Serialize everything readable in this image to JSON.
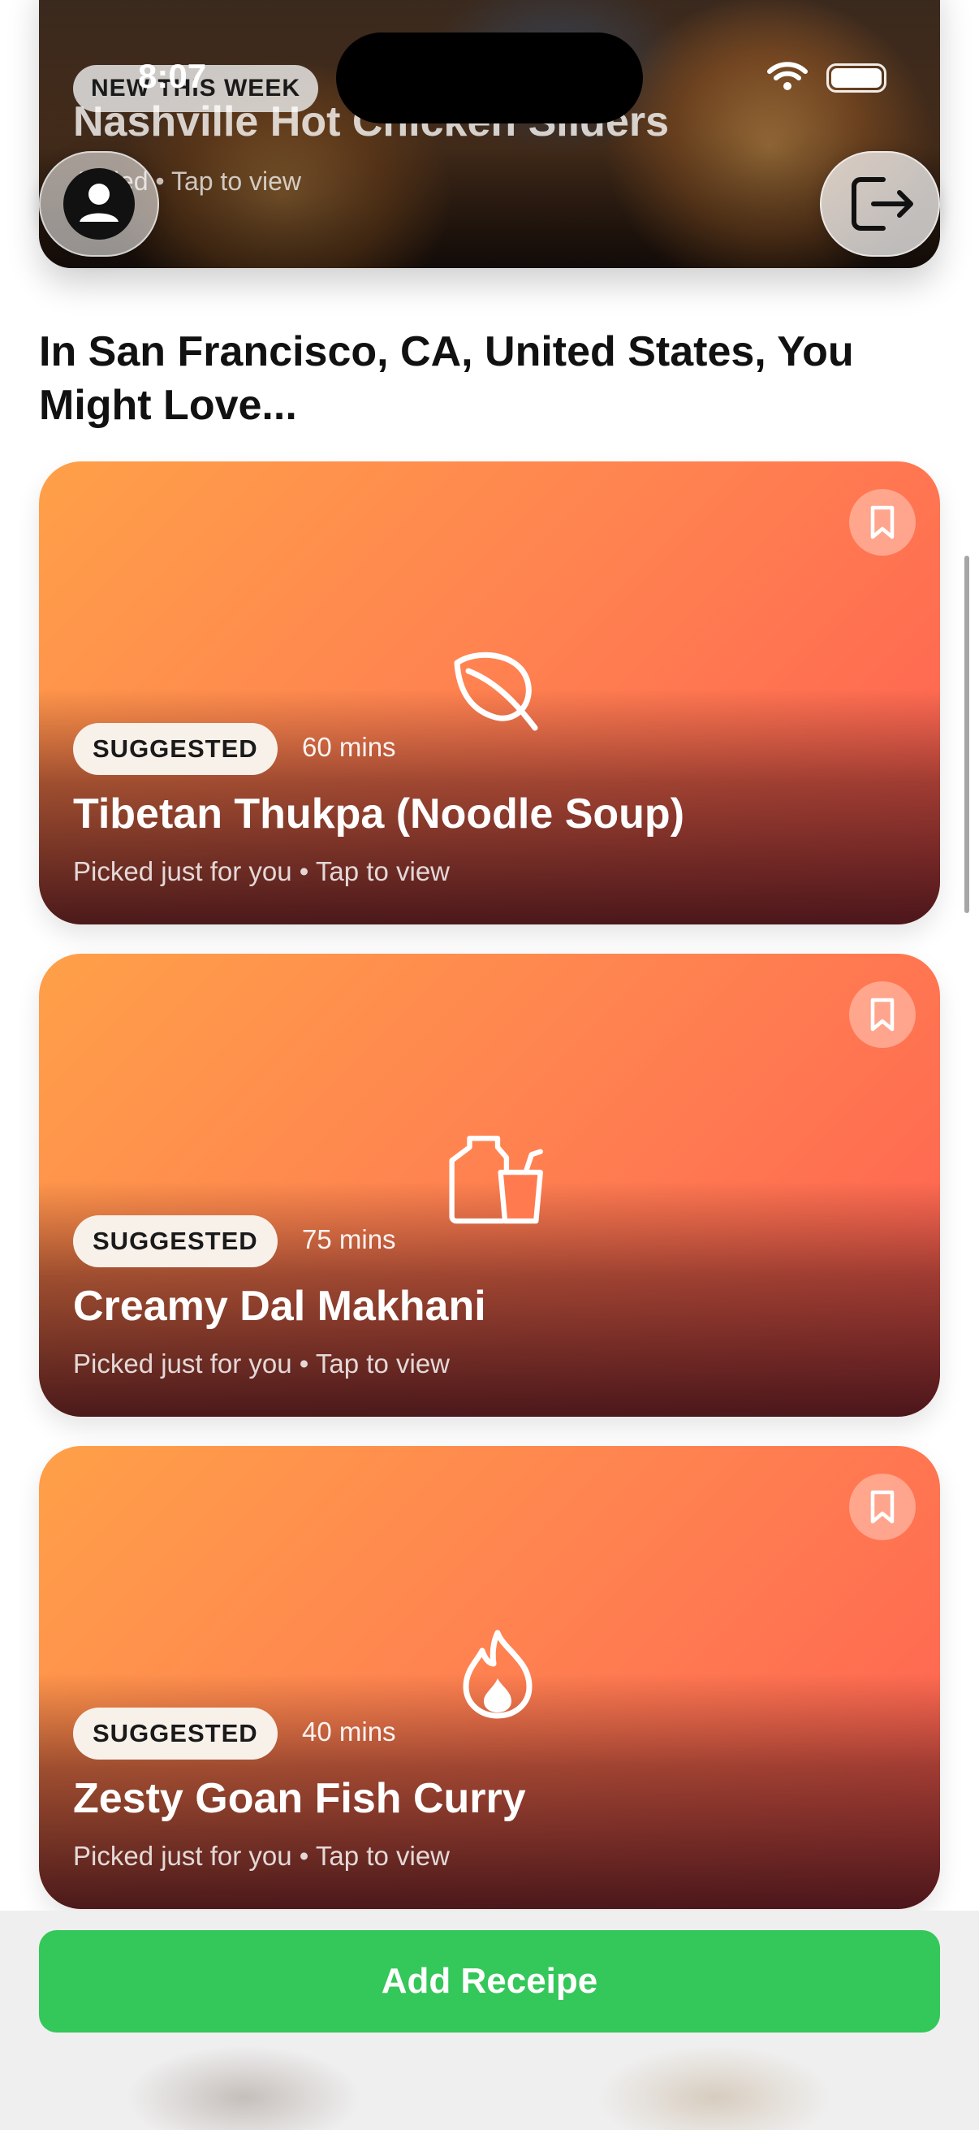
{
  "status_bar": {
    "time": "8:07"
  },
  "hero": {
    "badge": "NEW THIS WEEK",
    "title": "Nashville Hot Chicken Sliders",
    "subtitle": "Added • Tap to view"
  },
  "section": {
    "title": "In San Francisco, CA, United States, You Might Love..."
  },
  "cards": [
    {
      "badge": "SUGGESTED",
      "time": "60 mins",
      "title": "Tibetan Thukpa (Noodle Soup)",
      "subtitle": "Picked just for you • Tap to view",
      "icon": "leaf-icon"
    },
    {
      "badge": "SUGGESTED",
      "time": "75 mins",
      "title": "Creamy Dal Makhani",
      "subtitle": "Picked just for you • Tap to view",
      "icon": "jar-cup-icon"
    },
    {
      "badge": "SUGGESTED",
      "time": "40 mins",
      "title": "Zesty Goan Fish Curry",
      "subtitle": "Picked just for you • Tap to view",
      "icon": "flame-icon"
    }
  ],
  "actions": {
    "add_button": "Add Receipe"
  },
  "colors": {
    "card_gradient_start": "#ffa048",
    "card_gradient_end": "#ff5f52",
    "add_button": "#34c759"
  }
}
